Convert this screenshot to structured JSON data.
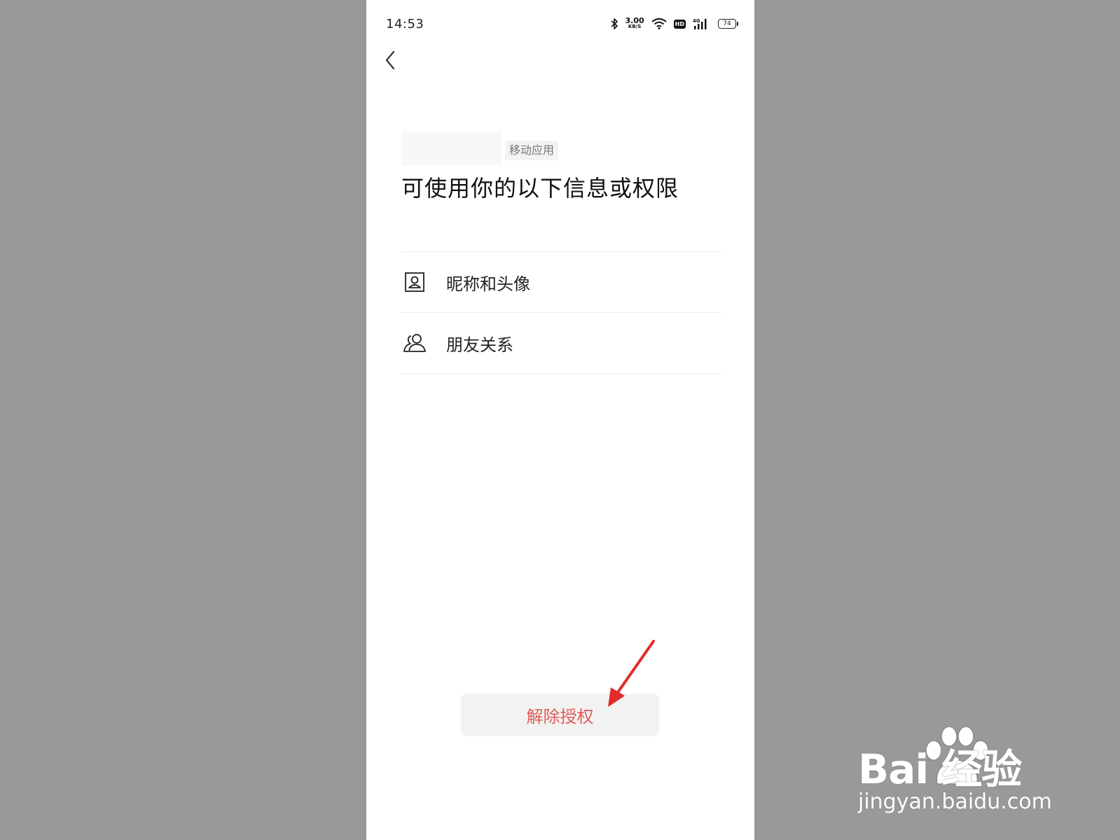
{
  "status_bar": {
    "time": "14:53",
    "net_speed_value": "3.00",
    "net_speed_unit": "KB/S",
    "hd_label": "HD",
    "network_label": "4G",
    "battery_level": "74",
    "icons": [
      "bluetooth-icon",
      "wifi-icon",
      "signal-icon",
      "battery-icon"
    ]
  },
  "header": {
    "back_icon": "chevron-left-icon"
  },
  "app": {
    "tag": "移动应用"
  },
  "page": {
    "title": "可使用你的以下信息或权限"
  },
  "permissions": [
    {
      "label": "昵称和头像",
      "icon": "profile-card-icon"
    },
    {
      "label": "朋友关系",
      "icon": "friends-icon"
    }
  ],
  "actions": {
    "revoke_label": "解除授权"
  },
  "annotation": {
    "arrow_color": "#e32b2b"
  },
  "watermark": {
    "brand": "Bai 经验",
    "url": "jingyan.baidu.com"
  },
  "colors": {
    "background": "#999999",
    "accent_red": "#e05b57",
    "button_bg": "#f2f2f2"
  }
}
